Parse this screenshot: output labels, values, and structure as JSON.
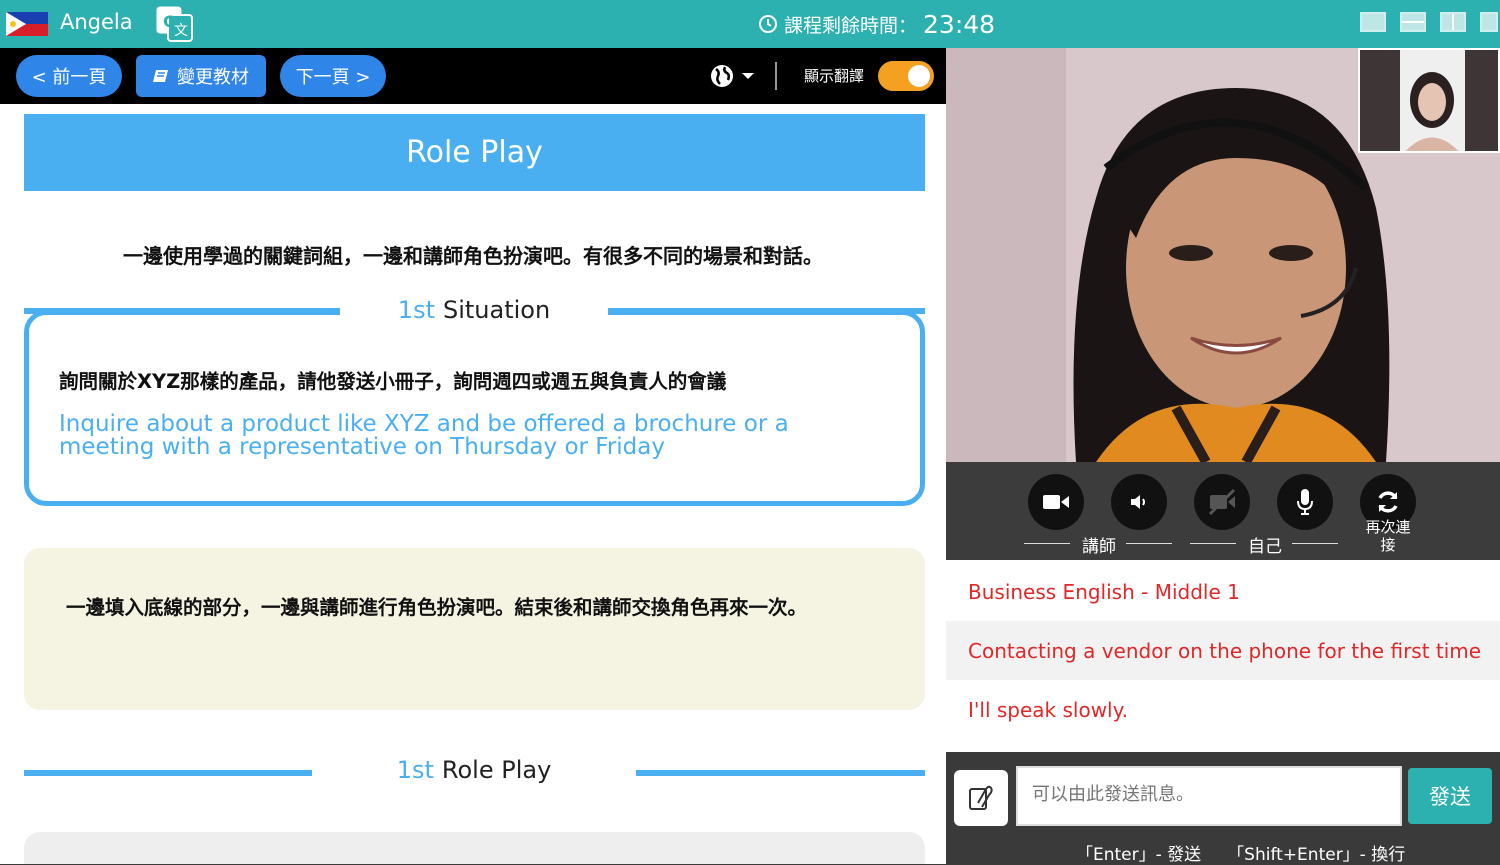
{
  "topbar": {
    "tutor_name": "Angela",
    "flag_icon": "philippines-flag-icon",
    "timer_label": "課程剩餘時間：",
    "timer_value": "23:48",
    "colors": {
      "bar": "#2db0b0"
    }
  },
  "toolbar": {
    "prev_label": "< 前一頁",
    "change_material_label": "變更教材",
    "next_label": "下一頁 >",
    "show_translation_label": "顯示翻譯",
    "translation_on": true
  },
  "material": {
    "banner_title": "Role Play",
    "intro": "一邊使用學過的關鍵詞組，一邊和講師角色扮演吧。有很多不同的場景和對話。",
    "situation": {
      "num": "1st",
      "title": "Situation",
      "zh": "詢問關於XYZ那樣的產品，請他發送小冊子，詢問週四或週五與負責人的會議",
      "en": "Inquire about a product like XYZ and be offered a brochure or a meeting with a representative on Thursday or Friday"
    },
    "note": "一邊填入底線的部分，一邊與講師進行角色扮演吧。結束後和講師交換角色再來一次。",
    "role_play": {
      "num": "1st",
      "title": "Role Play"
    }
  },
  "controls": {
    "teacher_label": "講師",
    "self_label": "自己",
    "reconnect_label": "再次連接"
  },
  "lesson": {
    "course": "Business English - Middle 1",
    "topic": "Contacting a vendor on the phone for the first time",
    "phrase": "I'll speak slowly."
  },
  "chat": {
    "placeholder": "可以由此發送訊息。",
    "send_label": "發送",
    "hint_enter": "「Enter」- 發送",
    "hint_shift": "「Shift+Enter」- 換行"
  }
}
